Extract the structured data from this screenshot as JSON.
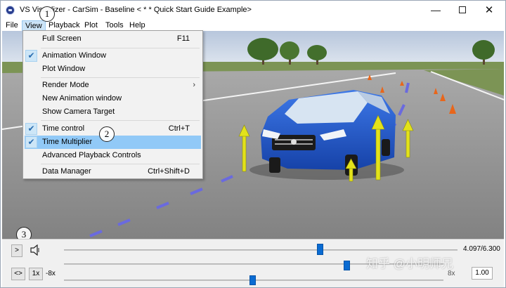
{
  "window": {
    "title": "VS Visualizer - CarSim - Baseline < * * Quick Start Guide Example>"
  },
  "menubar": {
    "items": [
      "File",
      "View",
      "Playback",
      "Plot",
      "Tools",
      "Help"
    ]
  },
  "view_menu": {
    "items": [
      {
        "label": "Full Screen",
        "shortcut": "F11",
        "checked": false
      },
      {
        "label": "Animation Window",
        "checked": true
      },
      {
        "label": "Plot Window",
        "checked": false
      },
      {
        "label": "Render Mode",
        "submenu": true
      },
      {
        "label": "New Animation window"
      },
      {
        "label": "Show Camera Target"
      },
      {
        "label": "Time control",
        "shortcut": "Ctrl+T",
        "checked": true
      },
      {
        "label": "Time Multiplier",
        "checked": true,
        "highlighted": true
      },
      {
        "label": "Advanced Playback Controls"
      },
      {
        "label": "Data Manager",
        "shortcut": "Ctrl+Shift+D"
      }
    ]
  },
  "callouts": [
    "1",
    "2",
    "3"
  ],
  "controls": {
    "play_label": ">",
    "loop_label": "<>",
    "speed_label": "1x",
    "time_readout": "4.097/6.300",
    "time_fraction": 0.65,
    "multiplier_min": "-8x",
    "multiplier_max": "8x",
    "multiplier_value": "1.00",
    "speaker_icon": "speaker-icon"
  },
  "watermark": "知乎 @小明师兄",
  "colors": {
    "car_body": "#1f56c9",
    "arrow": "#e3e21a",
    "sky": "#cfd9ea",
    "grass": "#6f8a4a",
    "road": "#8f8f8f",
    "cone": "#e8661b",
    "lane_line": "#6a6adf",
    "slider_thumb": "#0a6bd2",
    "menu_highlight": "#91c9f7"
  }
}
